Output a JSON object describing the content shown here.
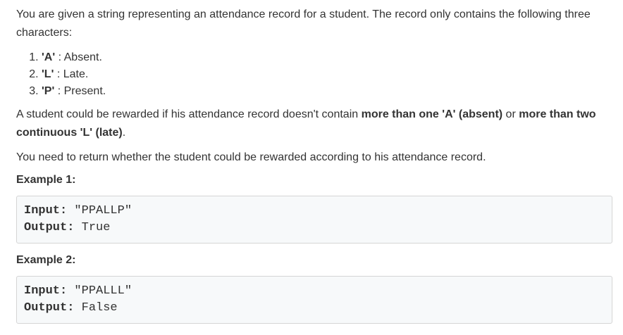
{
  "intro": "You are given a string representing an attendance record for a student. The record only contains the following three characters:",
  "items": [
    {
      "num": "1.",
      "code": "'A'",
      "desc": " : Absent."
    },
    {
      "num": "2.",
      "code": "'L'",
      "desc": " : Late."
    },
    {
      "num": "3.",
      "code": "'P'",
      "desc": " : Present."
    }
  ],
  "reward": {
    "part1": "A student could be rewarded if his attendance record doesn't contain ",
    "bold1": "more than one 'A' (absent)",
    "part2": " or ",
    "bold2": "more than two continuous 'L' (late)",
    "part3": "."
  },
  "task": "You need to return whether the student could be rewarded according to his attendance record.",
  "examples": [
    {
      "title": "Example 1:",
      "input_label": "Input:",
      "input_value": " \"PPALLP\"",
      "output_label": "Output:",
      "output_value": " True"
    },
    {
      "title": "Example 2:",
      "input_label": "Input:",
      "input_value": " \"PPALLL\"",
      "output_label": "Output:",
      "output_value": " False"
    }
  ]
}
